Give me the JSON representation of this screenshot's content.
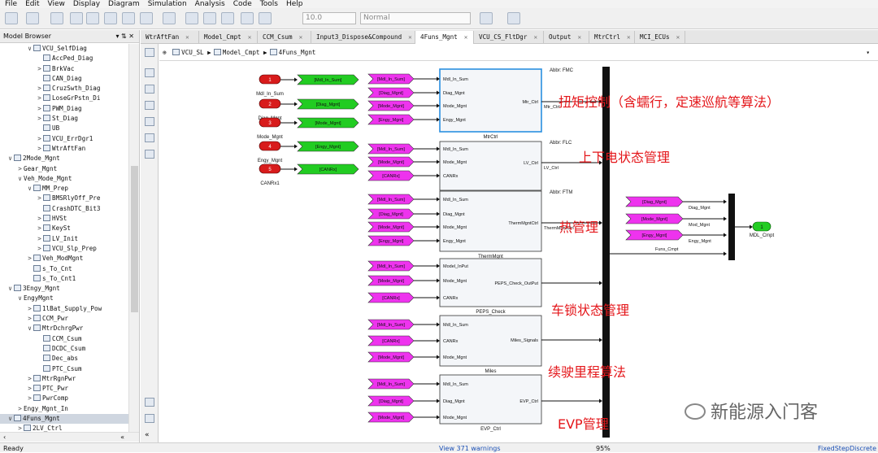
{
  "menu": [
    "File",
    "Edit",
    "View",
    "Display",
    "Diagram",
    "Simulation",
    "Analysis",
    "Code",
    "Tools",
    "Help"
  ],
  "toolbar": {
    "sim_time": "10.0",
    "sim_mode": "Normal"
  },
  "browser": {
    "title": "Model Browser",
    "pin": "«",
    "tree": [
      {
        "indent": 4,
        "arrow": "∨",
        "icon": true,
        "label": "VCU_SelfDiag"
      },
      {
        "indent": 5,
        "arrow": "",
        "icon": true,
        "label": "AccPed_Diag"
      },
      {
        "indent": 5,
        "arrow": ">",
        "icon": true,
        "label": "BrkVac"
      },
      {
        "indent": 5,
        "arrow": "",
        "icon": true,
        "label": "CAN_Diag"
      },
      {
        "indent": 5,
        "arrow": ">",
        "icon": true,
        "label": "CruzSwth_Diag"
      },
      {
        "indent": 5,
        "arrow": ">",
        "icon": true,
        "label": "LoseGrPstn_Di"
      },
      {
        "indent": 5,
        "arrow": ">",
        "icon": true,
        "label": "PWM_Diag"
      },
      {
        "indent": 5,
        "arrow": ">",
        "icon": true,
        "label": "St_Diag"
      },
      {
        "indent": 5,
        "arrow": "",
        "icon": true,
        "label": "UB"
      },
      {
        "indent": 5,
        "arrow": ">",
        "icon": true,
        "label": "VCU_ErrDgr1"
      },
      {
        "indent": 5,
        "arrow": ">",
        "icon": true,
        "label": "WtrAftFan"
      },
      {
        "indent": 2,
        "arrow": "∨",
        "icon": true,
        "label": "2Mode_Mgnt"
      },
      {
        "indent": 3,
        "arrow": ">",
        "icon": false,
        "label": "Gear_Mgnt"
      },
      {
        "indent": 3,
        "arrow": "∨",
        "icon": false,
        "label": "Veh_Mode_Mgnt"
      },
      {
        "indent": 4,
        "arrow": "∨",
        "icon": true,
        "label": "MM_Prep"
      },
      {
        "indent": 5,
        "arrow": ">",
        "icon": true,
        "label": "BMSRlyOff_Pre"
      },
      {
        "indent": 5,
        "arrow": "",
        "icon": true,
        "label": "CrashDTC_Bit3"
      },
      {
        "indent": 5,
        "arrow": ">",
        "icon": true,
        "label": "HVSt"
      },
      {
        "indent": 5,
        "arrow": ">",
        "icon": true,
        "label": "KeySt"
      },
      {
        "indent": 5,
        "arrow": ">",
        "icon": true,
        "label": "LV_Init"
      },
      {
        "indent": 5,
        "arrow": ">",
        "icon": true,
        "label": "VCU_Slp_Prep"
      },
      {
        "indent": 4,
        "arrow": ">",
        "icon": true,
        "label": "Veh_ModMgnt"
      },
      {
        "indent": 4,
        "arrow": "",
        "icon": true,
        "label": "s_To_Cnt"
      },
      {
        "indent": 4,
        "arrow": "",
        "icon": true,
        "label": "s_To_Cnt1"
      },
      {
        "indent": 2,
        "arrow": "∨",
        "icon": true,
        "label": "3Engy_Mgnt"
      },
      {
        "indent": 3,
        "arrow": "∨",
        "icon": false,
        "label": "EngyMgnt"
      },
      {
        "indent": 4,
        "arrow": ">",
        "icon": true,
        "label": "1lBat_Supply_Pow"
      },
      {
        "indent": 4,
        "arrow": ">",
        "icon": true,
        "label": "CCM_Pwr"
      },
      {
        "indent": 4,
        "arrow": "∨",
        "icon": true,
        "label": "MtrDchrgPwr"
      },
      {
        "indent": 5,
        "arrow": "",
        "icon": true,
        "label": "CCM_Csum"
      },
      {
        "indent": 5,
        "arrow": "",
        "icon": true,
        "label": "DCDC_Csum"
      },
      {
        "indent": 5,
        "arrow": "",
        "icon": true,
        "label": "Dec_abs"
      },
      {
        "indent": 5,
        "arrow": "",
        "icon": true,
        "label": "PTC_Csum"
      },
      {
        "indent": 4,
        "arrow": ">",
        "icon": true,
        "label": "MtrRgnPwr"
      },
      {
        "indent": 4,
        "arrow": ">",
        "icon": true,
        "label": "PTC_Pwr"
      },
      {
        "indent": 4,
        "arrow": ">",
        "icon": true,
        "label": "PwrComp"
      },
      {
        "indent": 3,
        "arrow": ">",
        "icon": false,
        "label": "Engy_Mgnt_In"
      },
      {
        "indent": 2,
        "arrow": "∨",
        "icon": true,
        "label": "4Funs_Mgnt",
        "selected": true
      },
      {
        "indent": 3,
        "arrow": ">",
        "icon": true,
        "label": "2LV_Ctrl"
      }
    ]
  },
  "tabs": [
    "WtrAftFan",
    "Model_Cmpt",
    "CCM_Csum",
    "Input3_Dispose&Compound",
    "4Funs_Mgnt",
    "VCU_CS_FltDgr",
    "Output",
    "MtrCtrl",
    "MCI_ECUs"
  ],
  "active_tab": "4Funs_Mgnt",
  "breadcrumb": [
    "VCU_SL",
    "Model_Cmpt",
    "4Funs_Mgnt"
  ],
  "diagram": {
    "inports": [
      "Mdl_In_Sum",
      "Diag_Mgnt",
      "Mode_Mgnt",
      "Engy_Mgnt",
      "CANRx1"
    ],
    "gotos": [
      "[Mdl_In_Sum]",
      "[Diag_Mgnt]",
      "[Mode_Mgnt]",
      "[Engy_Mgnt]",
      "[CANRx]"
    ],
    "subsystems": [
      {
        "name": "MtrCtrl",
        "abbr": "Abbr: FMC",
        "inputs": [
          "Mdl_In_Sum",
          "Diag_Mgnt",
          "Mode_Mgnt",
          "Engy_Mgnt"
        ],
        "froms": [
          "[Mdl_In_Sum]",
          "[Diag_Mgnt]",
          "[Mode_Mgnt]",
          "[Engy_Mgnt]"
        ],
        "output": "Mtr_Ctrl",
        "signal": "Mtr_Ctrl"
      },
      {
        "name": "2LV_Ctrl",
        "abbr": "Abbr: FLC",
        "inputs": [
          "Mdl_In_Sum",
          "Mode_Mgnt",
          "CANRx"
        ],
        "froms": [
          "[Mdl_In_Sum]",
          "[Mode_Mgnt]",
          "[CANRx]"
        ],
        "output": "LV_Ctrl",
        "signal": "LV_Ctrl"
      },
      {
        "name": "ThermMgnt",
        "abbr": "Abbr: FTM",
        "inputs": [
          "Mdl_In_Sum",
          "Diag_Mgnt",
          "Mode_Mgnt",
          "Engy_Mgnt"
        ],
        "froms": [
          "[Mdl_In_Sum]",
          "[Diag_Mgnt]",
          "[Mode_Mgnt]",
          "[Engy_Mgnt]"
        ],
        "output": "ThermMgntCtrl",
        "signal": "ThermMgntCtrl"
      },
      {
        "name": "PEPS_Check",
        "abbr": "",
        "inputs": [
          "Model_InPut",
          "Mode_Mgnt",
          "CANRx"
        ],
        "froms": [
          "[Mdl_In_Sum]",
          "[Mode_Mgnt]",
          "[CANRx]"
        ],
        "output": "PEPS_Check_OutPut",
        "signal": ""
      },
      {
        "name": "Miles",
        "abbr": "",
        "inputs": [
          "Mdl_In_Sum",
          "CANRx",
          "Mode_Mgnt"
        ],
        "froms": [
          "[Mdl_In_Sum]",
          "[CANRx]",
          "[Mode_Mgnt]"
        ],
        "output": "Miles_Signals",
        "signal": ""
      },
      {
        "name": "EVP_Ctrl",
        "abbr": "",
        "inputs": [
          "Mdl_In_Sum",
          "Diag_Mgnt",
          "Mode_Mgnt"
        ],
        "froms": [
          "[Mdl_In_Sum]",
          "[Diag_Mgnt]",
          "[Mode_Mgnt]"
        ],
        "output": "EVP_Ctrl",
        "signal": ""
      }
    ],
    "right_froms": [
      "[Diag_Mgnt]",
      "[Mode_Mgnt]",
      "[Engy_Mgnt]"
    ],
    "right_signals": [
      "Diag_Mgnt",
      "Mod_Mgnt",
      "Engy_Mgnt"
    ],
    "funs_signal": "Funs_Cmpt",
    "outport": "MDL_Cmpt",
    "outport_num": "1"
  },
  "annotations": [
    "扭矩控制（含蠕行，定速巡航等算法）",
    "上下电状态管理",
    "热管理",
    "车锁状态管理",
    "续驶里程算法",
    "EVP管理"
  ],
  "watermark": "新能源入门客",
  "status": {
    "left": "Ready",
    "warnings": "View 371 warnings",
    "zoom": "95%",
    "solver": "FixedStepDiscrete"
  },
  "colors": {
    "inport": "#d81b1b",
    "goto": "#22cc22",
    "from": "#ee33ee",
    "bus": "#111111",
    "annotation": "#e4161a"
  }
}
